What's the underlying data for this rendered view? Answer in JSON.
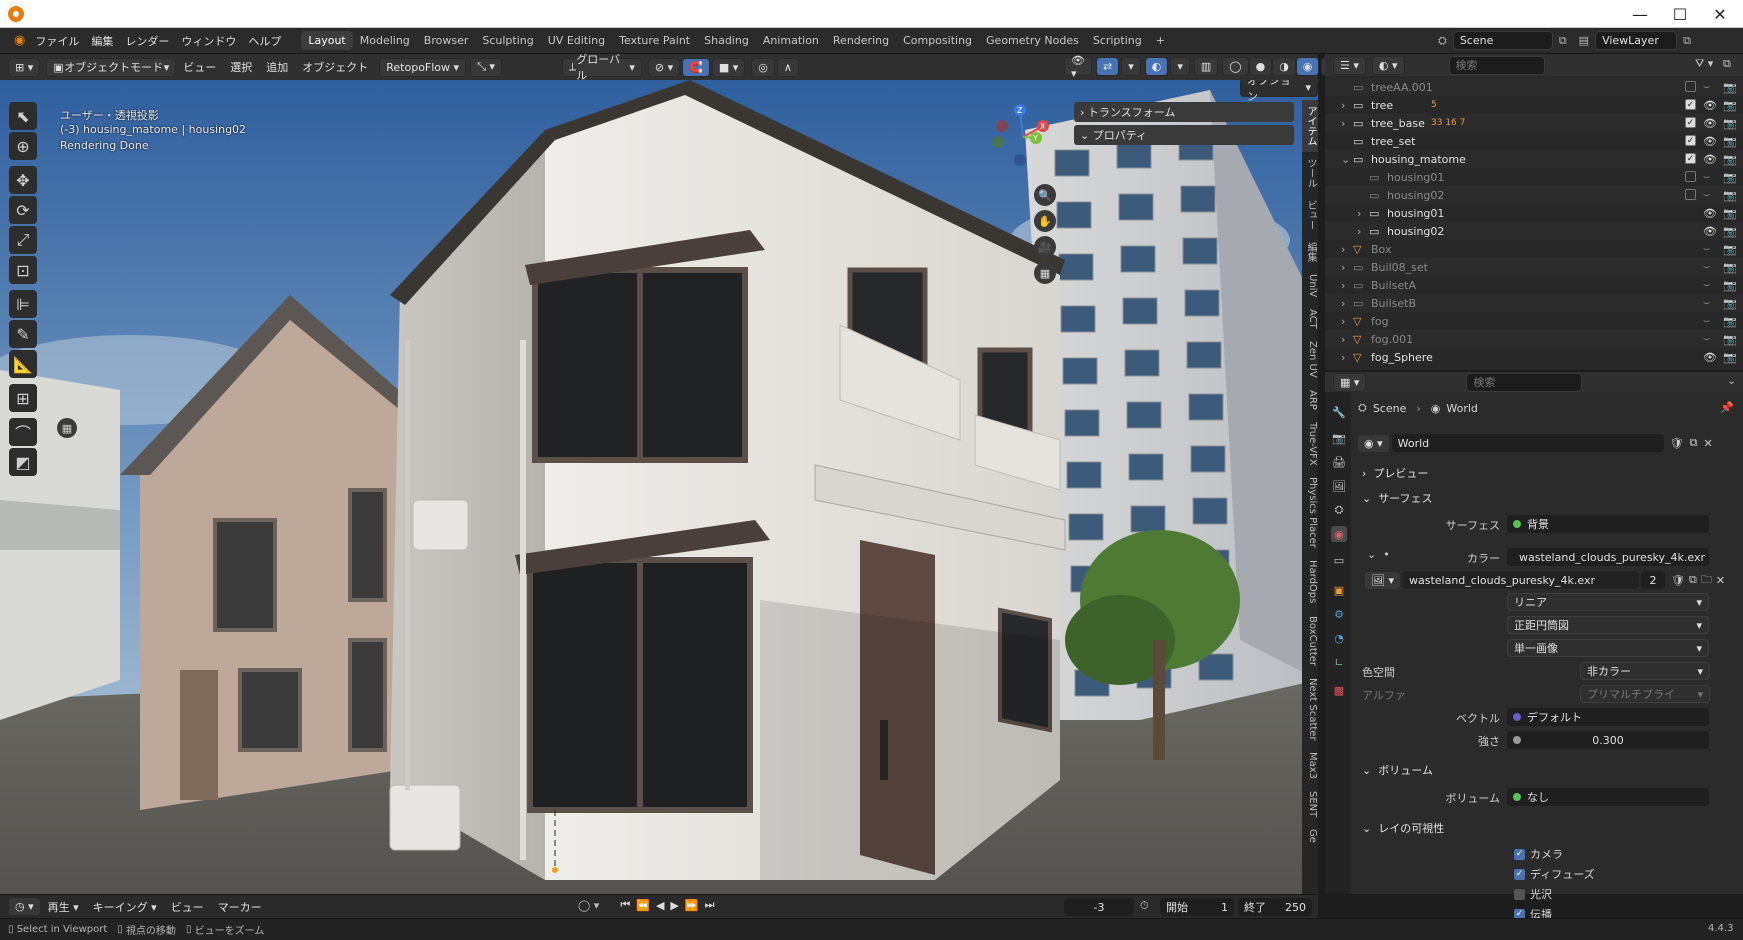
{
  "menu": {
    "items": [
      "ファイル",
      "編集",
      "レンダー",
      "ウィンドウ",
      "ヘルプ"
    ],
    "workspaces": [
      "Layout",
      "Modeling",
      "Browser",
      "Sculpting",
      "UV Editing",
      "Texture Paint",
      "Shading",
      "Animation",
      "Rendering",
      "Compositing",
      "Geometry Nodes",
      "Scripting"
    ],
    "add_tab": "+",
    "scene": "Scene",
    "view_layer": "ViewLayer"
  },
  "viewport_header": {
    "mode": "オブジェクトモード",
    "view": "ビュー",
    "select": "選択",
    "add": "追加",
    "object": "オブジェクト",
    "addon": "RetopoFlow",
    "orientation": "グローバル",
    "options": "オプション"
  },
  "viewport": {
    "view_name": "ユーザー・透視投影",
    "collection_info": "(-3) housing_matome | housing02",
    "render_status": "Rendering Done"
  },
  "npanel": {
    "transform": "トランスフォーム",
    "properties": "プロパティ",
    "tabs": [
      "アイテム",
      "ツール",
      "ビュー",
      "編集",
      "UniV",
      "ACT",
      "Zen UV",
      "ARP",
      "True-VFX",
      "Physics Placer",
      "HardOps",
      "BoxCutter",
      "Next Scatter",
      "Max3",
      "SENT",
      "Ge"
    ]
  },
  "outliner": {
    "search_placeholder": "検索",
    "rows": [
      {
        "name": "treeAA.001",
        "dim": true
      },
      {
        "name": "tree",
        "dim": false,
        "badge": "5"
      },
      {
        "name": "tree_base",
        "dim": false,
        "badge": "33 16 7"
      },
      {
        "name": "tree_set",
        "dim": false
      },
      {
        "name": "housing_matome",
        "dim": false
      },
      {
        "name": "housing01",
        "dim": true
      },
      {
        "name": "housing02",
        "dim": true
      },
      {
        "name": "housing01",
        "dim": false
      },
      {
        "name": "housing02",
        "dim": false
      },
      {
        "name": "Box",
        "dim": true
      },
      {
        "name": "Buil08_set",
        "dim": true
      },
      {
        "name": "BuilsetA",
        "dim": true
      },
      {
        "name": "BuilsetB",
        "dim": true
      },
      {
        "name": "fog",
        "dim": true
      },
      {
        "name": "fog.001",
        "dim": true
      },
      {
        "name": "fog_Sphere",
        "dim": false
      }
    ]
  },
  "properties": {
    "search_placeholder": "検索",
    "breadcrumb_scene": "Scene",
    "breadcrumb_world": "World",
    "world_name": "World",
    "preview": "プレビュー",
    "surface_section": "サーフェス",
    "surface_label": "サーフェス",
    "surface_value": "背景",
    "color_label": "カラー",
    "color_value": "wasteland_clouds_puresky_4k.exr",
    "image_name": "wasteland_clouds_puresky_4k.exr",
    "image_users": "2",
    "interpolation": "リニア",
    "projection": "正距円筒図",
    "source": "単一画像",
    "colorspace_label": "色空間",
    "colorspace_value": "非カラー",
    "alpha_label": "アルファ",
    "alpha_value": "プリマルチプライ",
    "vector_label": "ベクトル",
    "vector_value": "デフォルト",
    "strength_label": "強さ",
    "strength_value": "0.300",
    "volume_section": "ボリューム",
    "volume_label": "ボリューム",
    "volume_value": "なし",
    "ray_section": "レイの可視性",
    "ray_items": [
      {
        "label": "カメラ",
        "checked": true
      },
      {
        "label": "ディフューズ",
        "checked": true
      },
      {
        "label": "光沢",
        "checked": false
      },
      {
        "label": "伝播",
        "checked": true
      }
    ]
  },
  "timeline": {
    "playback": "再生",
    "keying": "キーイング",
    "view": "ビュー",
    "marker": "マーカー",
    "current_frame": "-3",
    "start_label": "開始",
    "start_value": "1",
    "end_label": "終了",
    "end_value": "250"
  },
  "statusbar": {
    "select": "Select in Viewport",
    "move": "視点の移動",
    "zoom": "ビューをズーム",
    "version": "4.4.3"
  }
}
